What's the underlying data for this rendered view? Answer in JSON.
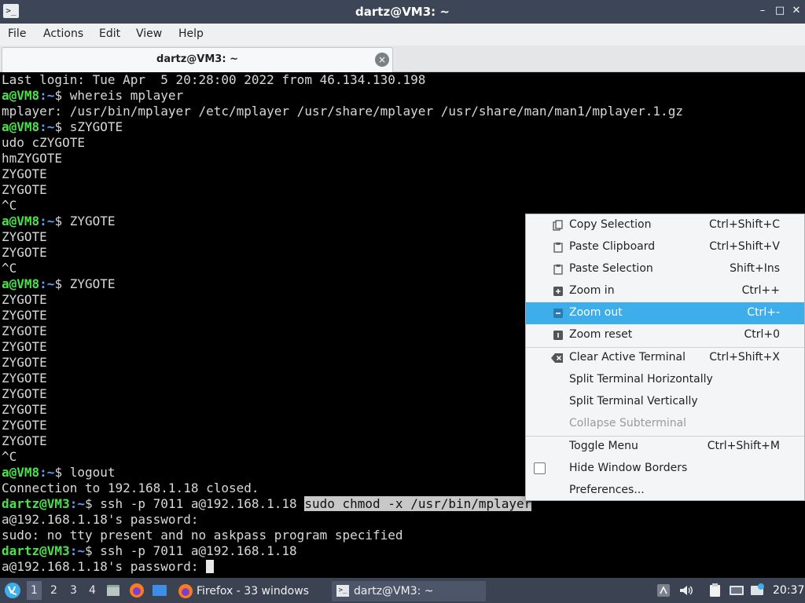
{
  "window": {
    "title": "dartz@VM3: ~",
    "app_icon": ">_",
    "minimize": "–",
    "maximize": "□",
    "close": "✕"
  },
  "menubar": [
    "File",
    "Actions",
    "Edit",
    "View",
    "Help"
  ],
  "tab": {
    "label": "dartz@VM3: ~",
    "close": "×"
  },
  "terminal": {
    "lines": [
      [
        {
          "t": "Last login: Tue Apr  5 20:28:00 2022 from 46.134.130.198"
        }
      ],
      [
        {
          "t": "a@VM8",
          "c": "user"
        },
        {
          "t": ":~",
          "c": "path"
        },
        {
          "t": "$ whereis mplayer"
        }
      ],
      [
        {
          "t": "mplayer: /usr/bin/mplayer /etc/mplayer /usr/share/mplayer /usr/share/man/man1/mplayer.1.gz"
        }
      ],
      [
        {
          "t": "a@VM8",
          "c": "user"
        },
        {
          "t": ":~",
          "c": "path"
        },
        {
          "t": "$ sZYGOTE"
        }
      ],
      [
        {
          "t": "udo cZYGOTE"
        }
      ],
      [
        {
          "t": "hmZYGOTE"
        }
      ],
      [
        {
          "t": "ZYGOTE"
        }
      ],
      [
        {
          "t": "ZYGOTE"
        }
      ],
      [
        {
          "t": "^C"
        }
      ],
      [
        {
          "t": "a@VM8",
          "c": "user"
        },
        {
          "t": ":~",
          "c": "path"
        },
        {
          "t": "$ ZYGOTE"
        }
      ],
      [
        {
          "t": "ZYGOTE"
        }
      ],
      [
        {
          "t": "ZYGOTE"
        }
      ],
      [
        {
          "t": "^C"
        }
      ],
      [
        {
          "t": "a@VM8",
          "c": "user"
        },
        {
          "t": ":~",
          "c": "path"
        },
        {
          "t": "$ ZYGOTE"
        }
      ],
      [
        {
          "t": "ZYGOTE"
        }
      ],
      [
        {
          "t": "ZYGOTE"
        }
      ],
      [
        {
          "t": "ZYGOTE"
        }
      ],
      [
        {
          "t": "ZYGOTE"
        }
      ],
      [
        {
          "t": "ZYGOTE"
        }
      ],
      [
        {
          "t": "ZYGOTE"
        }
      ],
      [
        {
          "t": "ZYGOTE"
        }
      ],
      [
        {
          "t": "ZYGOTE"
        }
      ],
      [
        {
          "t": "ZYGOTE"
        }
      ],
      [
        {
          "t": "ZYGOTE"
        }
      ],
      [
        {
          "t": "^C"
        }
      ],
      [
        {
          "t": "a@VM8",
          "c": "user"
        },
        {
          "t": ":~",
          "c": "path"
        },
        {
          "t": "$ logout"
        }
      ],
      [
        {
          "t": "Connection to 192.168.1.18 closed."
        }
      ],
      [
        {
          "t": "dartz@VM3",
          "c": "user"
        },
        {
          "t": ":~",
          "c": "path"
        },
        {
          "t": "$ ssh -p 7011 a@192.168.1.18 "
        },
        {
          "t": "sudo chmod -x /usr/bin/mplayer",
          "c": "sel"
        }
      ],
      [
        {
          "t": "a@192.168.1.18's password:"
        }
      ],
      [
        {
          "t": "sudo: no tty present and no askpass program specified"
        }
      ],
      [
        {
          "t": "dartz@VM3",
          "c": "user"
        },
        {
          "t": ":~",
          "c": "path"
        },
        {
          "t": "$ ssh -p 7011 a@192.168.1.18"
        }
      ],
      [
        {
          "t": "a@192.168.1.18's password: "
        },
        {
          "t": "",
          "c": "cursor"
        }
      ]
    ]
  },
  "context_menu": {
    "items": [
      {
        "name": "copy-selection",
        "icon": "copy-icon",
        "label": "Copy Selection",
        "shortcut": "Ctrl+Shift+C"
      },
      {
        "name": "paste-clipboard",
        "icon": "paste-icon",
        "label": "Paste Clipboard",
        "shortcut": "Ctrl+Shift+V"
      },
      {
        "name": "paste-selection",
        "icon": "paste-icon",
        "label": "Paste Selection",
        "shortcut": "Shift+Ins"
      },
      {
        "name": "zoom-in",
        "icon": "zoom-in-icon",
        "label": "Zoom in",
        "shortcut": "Ctrl++"
      },
      {
        "name": "zoom-out",
        "icon": "zoom-out-icon",
        "label": "Zoom out",
        "shortcut": "Ctrl+-",
        "highlighted": true
      },
      {
        "name": "zoom-reset",
        "icon": "zoom-reset-icon",
        "label": "Zoom reset",
        "shortcut": "Ctrl+0"
      },
      {
        "name": "clear-active-terminal",
        "icon": "clear-icon",
        "label": "Clear Active Terminal",
        "shortcut": "Ctrl+Shift+X"
      },
      {
        "name": "split-horizontally",
        "label": "Split Terminal Horizontally",
        "shortcut": ""
      },
      {
        "name": "split-vertically",
        "label": "Split Terminal Vertically",
        "shortcut": ""
      },
      {
        "name": "collapse-subterminal",
        "label": "Collapse Subterminal",
        "shortcut": "",
        "disabled": true
      },
      {
        "name": "toggle-menu",
        "label": "Toggle Menu",
        "shortcut": "Ctrl+Shift+M"
      },
      {
        "name": "hide-window-borders",
        "label": "Hide Window Borders",
        "shortcut": "",
        "checkbox": true,
        "checked": false
      },
      {
        "name": "preferences",
        "label": "Preferences...",
        "shortcut": ""
      }
    ]
  },
  "taskbar": {
    "workspaces": [
      "1",
      "2",
      "3",
      "4"
    ],
    "active_workspace": "1",
    "tasks": [
      {
        "label": "Firefox - 33 windows",
        "icon": "firefox-icon"
      },
      {
        "label": "dartz@VM3: ~",
        "icon": "terminal-icon"
      }
    ],
    "clock": "20:37"
  },
  "colors": {
    "titlebar": "#3c4656",
    "highlight": "#3daee9",
    "prompt_user": "#4ce04c",
    "prompt_path": "#5aa0ff",
    "taskbar": "#3b4252"
  }
}
